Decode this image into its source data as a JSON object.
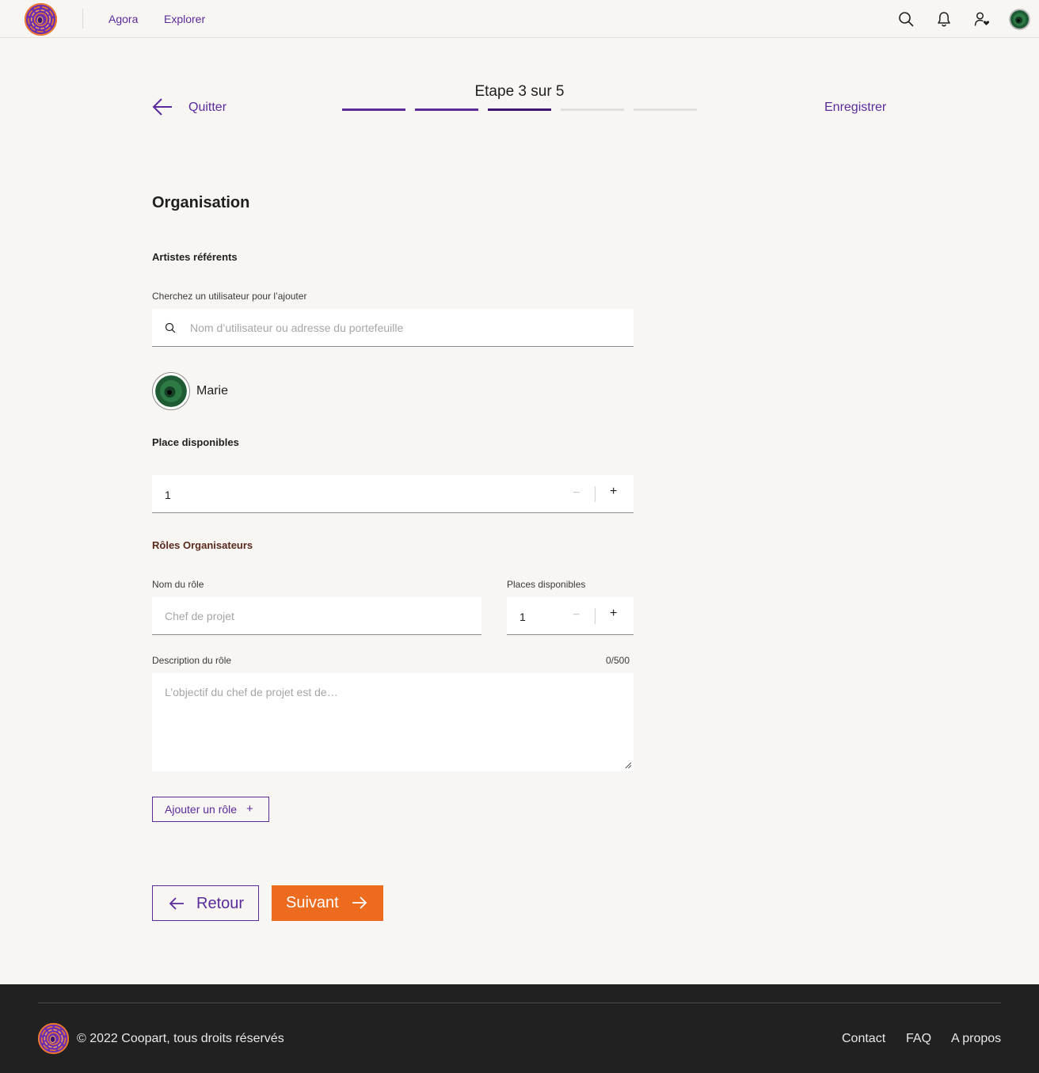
{
  "colors": {
    "accent": "#5b2a9c",
    "accent_dark": "#3c1570",
    "primary_button": "#ec6b1f",
    "background": "#f8f6f2",
    "footer_bg": "#212121",
    "section_brown": "#5a2a1e"
  },
  "header": {
    "nav": [
      "Agora",
      "Explorer"
    ],
    "icons": [
      "search-icon",
      "bell-icon",
      "user-heart-icon",
      "avatar"
    ]
  },
  "wizard": {
    "quit_label": "Quitter",
    "step_label": "Etape 3 sur 5",
    "current_step": 3,
    "total_steps": 5,
    "save_label": "Enregistrer"
  },
  "form": {
    "section_title": "Organisation",
    "artists": {
      "title": "Artistes référents",
      "search_label": "Cherchez un utilisateur pour l’ajouter",
      "search_placeholder": "Nom d’utilisateur ou adresse du portefeuille",
      "members": [
        {
          "name": "Marie"
        }
      ]
    },
    "places": {
      "title": "Place disponibles",
      "value": "1",
      "minus": "−",
      "plus": "+"
    },
    "roles": {
      "title": "Rôles Organisateurs",
      "name_label": "Nom du rôle",
      "name_placeholder": "Chef de projet",
      "places_label": "Places disponibles",
      "places_value": "1",
      "minus": "−",
      "plus": "+",
      "description_label": "Description du rôle",
      "description_counter": "0/500",
      "description_placeholder": "L’objectif du chef de projet est de…",
      "add_role_label": "Ajouter un rôle",
      "add_role_icon": "+"
    }
  },
  "actions": {
    "back_label": "Retour",
    "next_label": "Suivant"
  },
  "footer": {
    "copyright": "© 2022 Coopart, tous droits réservés",
    "links": [
      "Contact",
      "FAQ",
      "A propos"
    ]
  }
}
